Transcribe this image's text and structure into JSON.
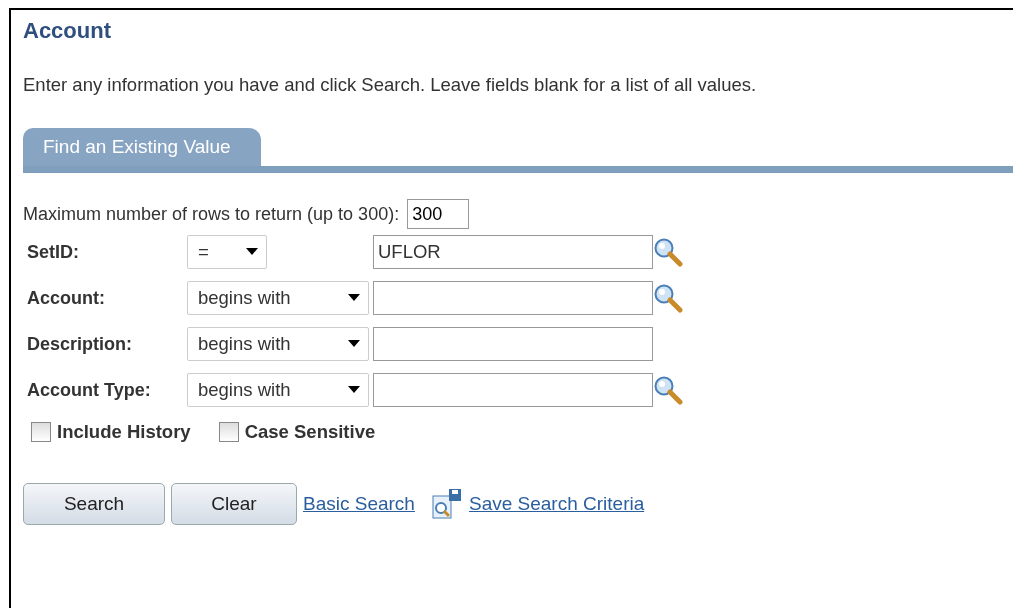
{
  "title": "Account",
  "instructions": "Enter any information you have and click Search. Leave fields blank for a list of all values.",
  "tabs": [
    {
      "label": "Find an Existing Value",
      "selected": true
    }
  ],
  "max_rows": {
    "label": "Maximum number of rows to return (up to 300):",
    "value": "300"
  },
  "criteria": [
    {
      "label": "SetID:",
      "operator": "=",
      "value": "UFLOR",
      "lookup": true
    },
    {
      "label": "Account:",
      "operator": "begins with",
      "lookup": true
    },
    {
      "label": "Description:",
      "operator": "begins with",
      "lookup": false
    },
    {
      "label": "Account Type:",
      "operator": "begins with",
      "lookup": true
    }
  ],
  "options": [
    {
      "label": "Include History",
      "checked": false
    },
    {
      "label": "Case Sensitive",
      "checked": false
    }
  ],
  "buttons": [
    "Search",
    "Clear"
  ],
  "links": [
    {
      "label": "Basic Search",
      "icon": false
    },
    {
      "label": "Save Search Criteria",
      "icon": true
    }
  ]
}
